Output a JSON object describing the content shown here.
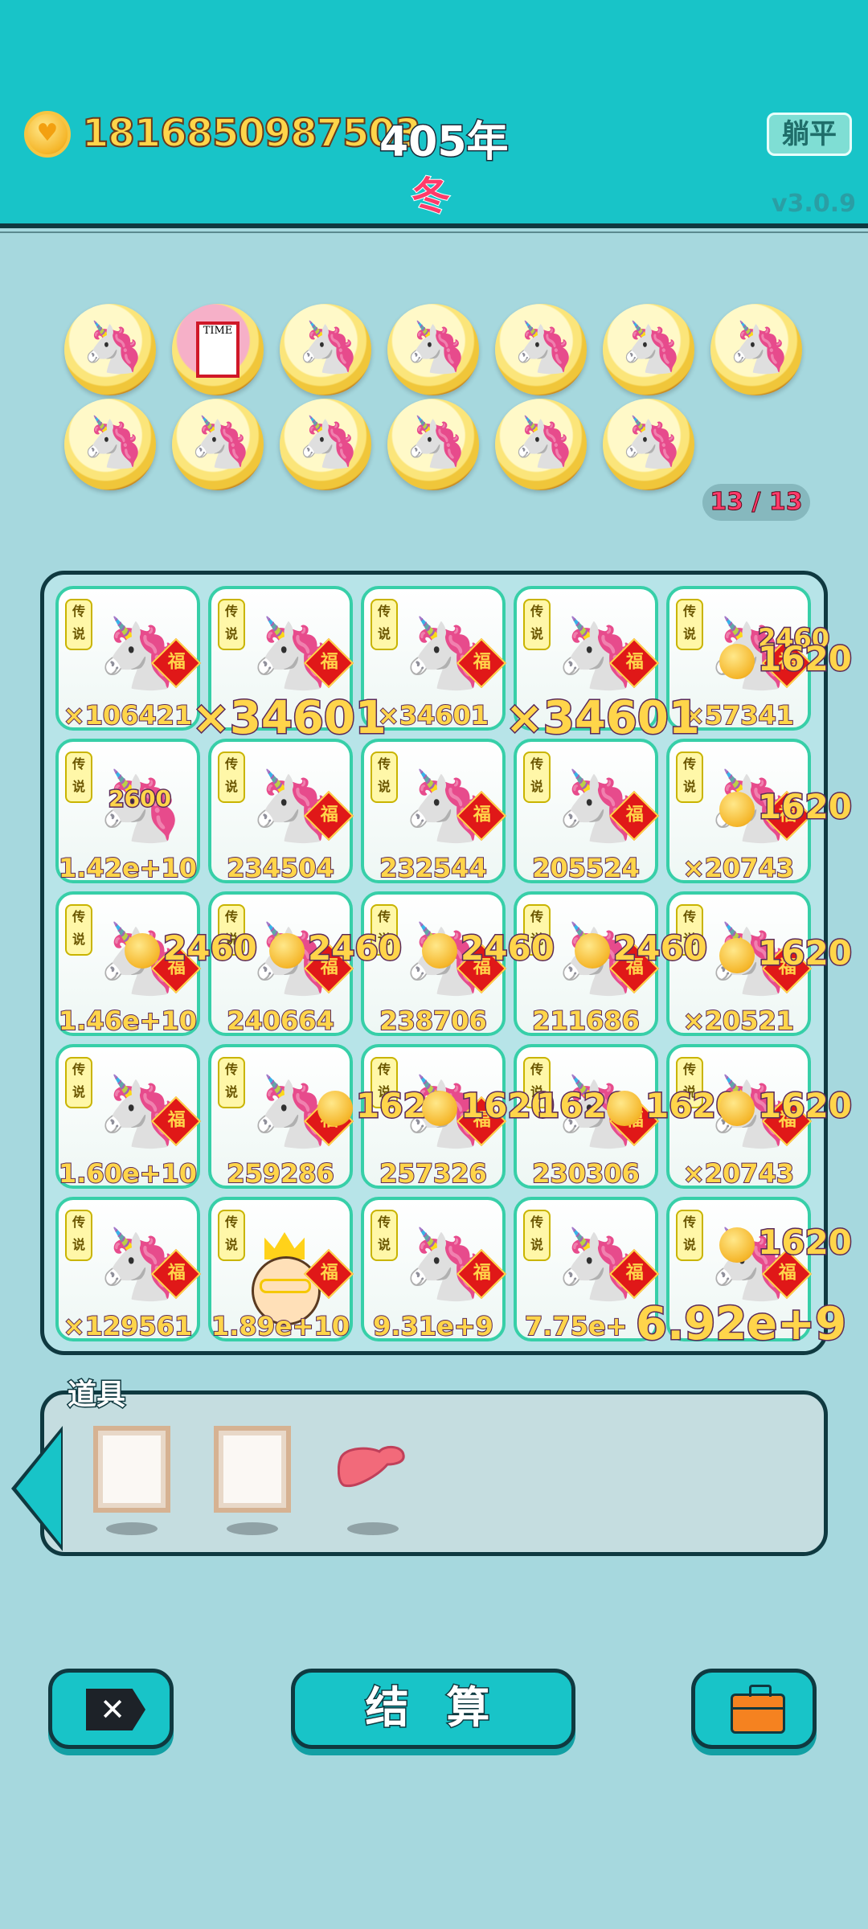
{
  "header": {
    "coins": "1816850987503",
    "year": "405年",
    "season": "冬",
    "flat_button": "躺平",
    "version": "v3.0.9"
  },
  "pool": {
    "counter": "13 / 13",
    "coins": [
      {
        "icon": "unicorn-coin"
      },
      {
        "icon": "time-magazine-coin"
      },
      {
        "icon": "unicorn-coin"
      },
      {
        "icon": "unicorn-coin"
      },
      {
        "icon": "unicorn-coin"
      },
      {
        "icon": "unicorn-coin"
      },
      {
        "icon": "unicorn-coin"
      },
      {
        "icon": "unicorn-coin"
      },
      {
        "icon": "unicorn-coin"
      },
      {
        "icon": "unicorn-coin"
      },
      {
        "icon": "unicorn-coin"
      },
      {
        "icon": "unicorn-coin"
      },
      {
        "icon": "unicorn-coin"
      }
    ],
    "time_label": "TIME"
  },
  "board": {
    "tag": "传说",
    "fu": "福",
    "tiles": [
      [
        "×106421",
        "",
        "×34601",
        "",
        "×57341"
      ],
      [
        "1.42e+10",
        "234504",
        "232544",
        "205524",
        "×20743"
      ],
      [
        "1.46e+10",
        "240664",
        "238706",
        "211686",
        "×20521"
      ],
      [
        "1.60e+10",
        "259286",
        "257326",
        "230306",
        "×20743"
      ],
      [
        "×129561",
        "1.89e+10",
        "9.31e+9",
        "7.75e+",
        ""
      ]
    ],
    "floats": {
      "r0_big1": "×34601",
      "r0_big2": "×34601",
      "r0_c4_small": "2460",
      "r0_c4_big": "1620",
      "r1_c0": "2600",
      "r1_c4": "1620",
      "r2_vals": [
        "2460",
        "2460",
        "2460",
        "2460",
        "1620"
      ],
      "r3_vals": [
        "1620",
        "1620",
        "1620",
        "1620",
        "1620"
      ],
      "r4_c4": "1620",
      "r4_big": "6.92e+9"
    }
  },
  "items": {
    "title": "道具",
    "slots": [
      {
        "icon": "wooden-frame"
      },
      {
        "icon": "wooden-frame"
      },
      {
        "icon": "liver"
      }
    ]
  },
  "buttons": {
    "settle": "结 算",
    "close_icon": "close-icon",
    "bag_icon": "briefcase-icon"
  },
  "colors": {
    "header": "#18c4c8",
    "background": "#a6d8de",
    "coin_text": "#ffd54a",
    "season": "#ff3b6a"
  }
}
